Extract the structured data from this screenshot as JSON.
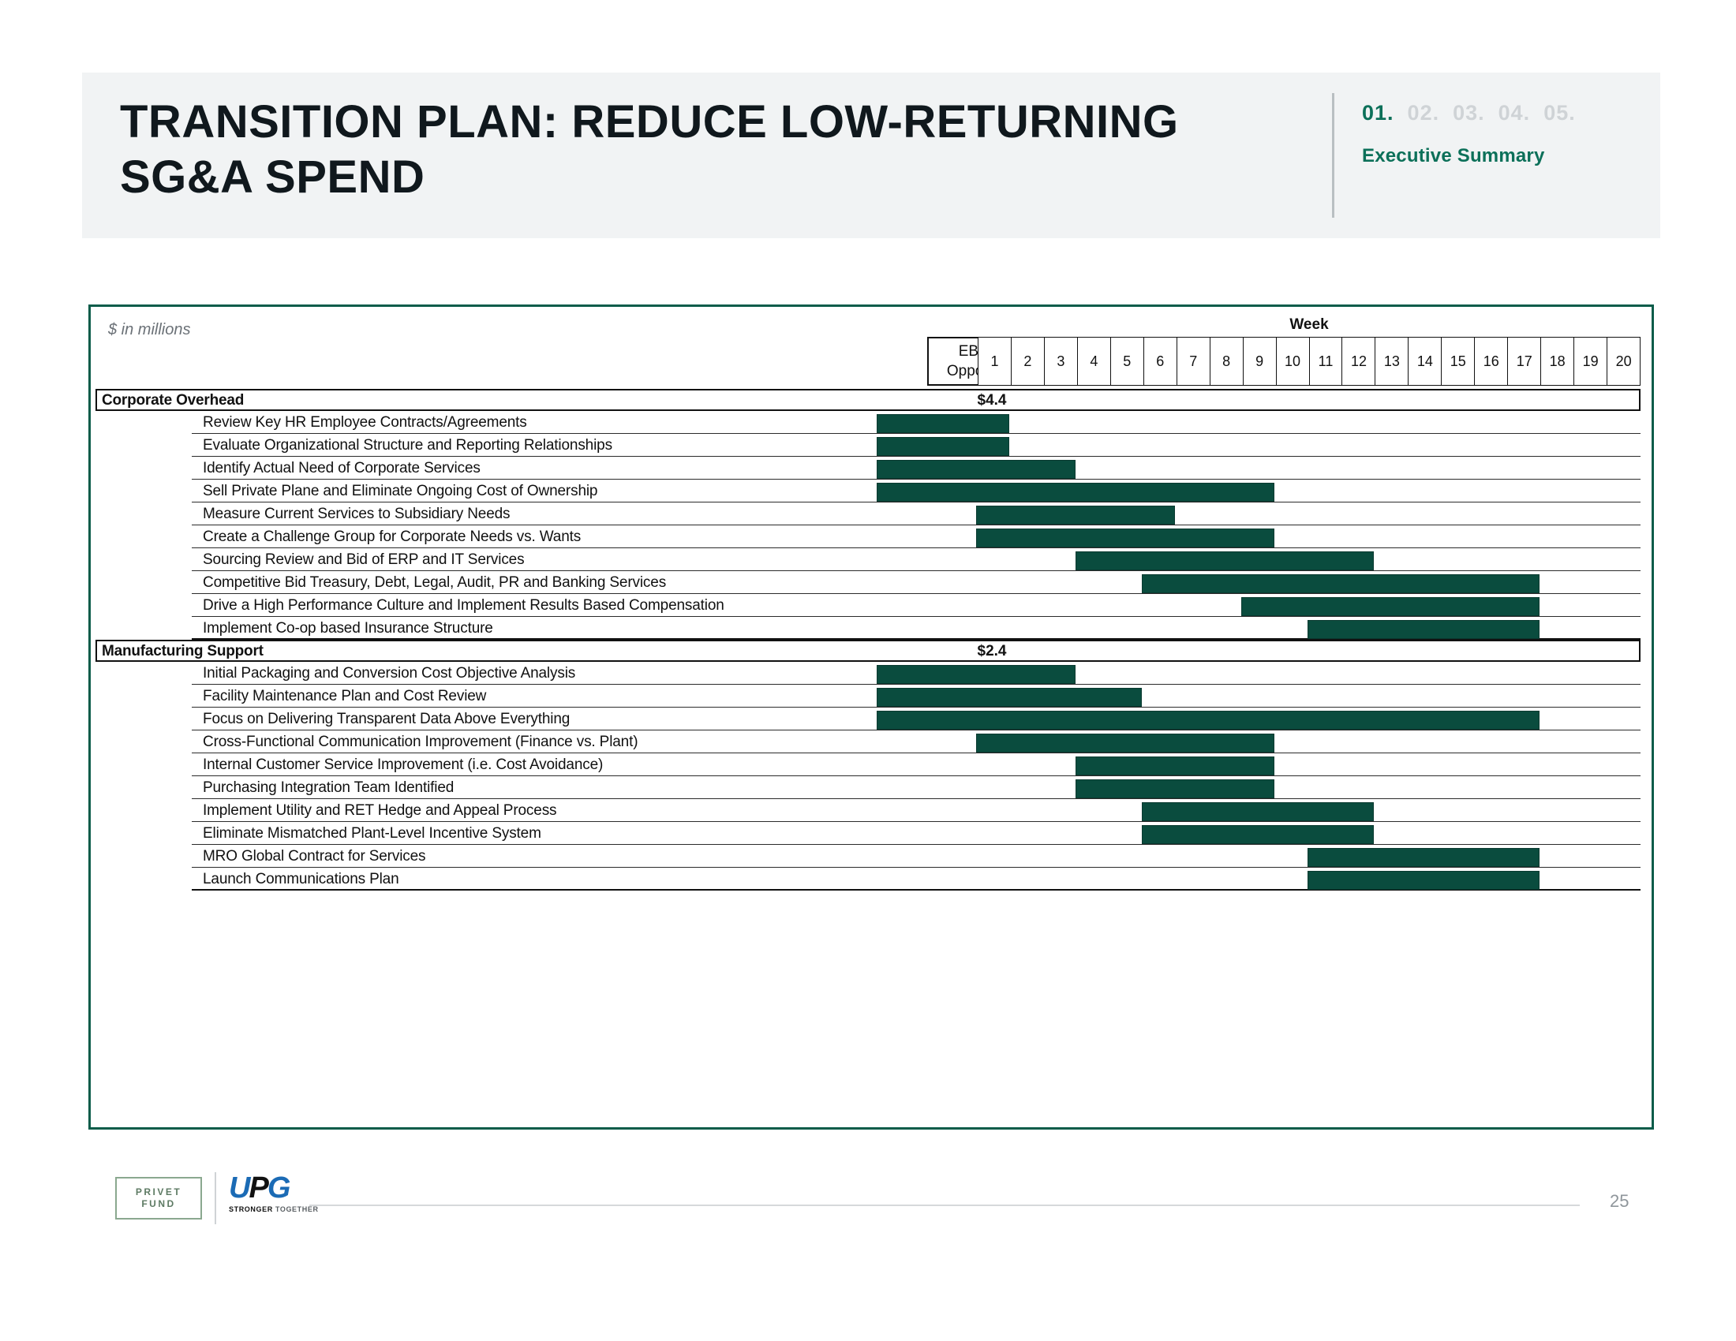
{
  "header": {
    "title": "TRANSITION PLAN: REDUCE LOW-RETURNING SG&A SPEND",
    "steps": [
      {
        "label": "01.",
        "active": true
      },
      {
        "label": "02.",
        "active": false
      },
      {
        "label": "03.",
        "active": false
      },
      {
        "label": "04.",
        "active": false
      },
      {
        "label": "05.",
        "active": false
      }
    ],
    "section_label": "Executive Summary",
    "accent_color": "#0c7059",
    "inactive_color": "#cfd3d6"
  },
  "chart": {
    "units_note": "$ in millions",
    "ebitda_header_line1": "EBITDA",
    "ebitda_header_line2": "Opportunity",
    "week_header": "Week",
    "bar_color": "#0a4c3e",
    "border_color": "#0b5c4a"
  },
  "chart_data": {
    "type": "bar",
    "title": "TRANSITION PLAN: REDUCE LOW-RETURNING SG&A SPEND",
    "subtitle": "$ in millions",
    "xlabel": "Week",
    "ylabel": "",
    "x_ticks": [
      1,
      2,
      3,
      4,
      5,
      6,
      7,
      8,
      9,
      10,
      11,
      12,
      13,
      14,
      15,
      16,
      17,
      18,
      19,
      20
    ],
    "xlim": [
      1,
      20
    ],
    "grid": true,
    "legend": "none",
    "groups": [
      {
        "name": "Corporate Overhead",
        "ebitda_opportunity": "$4.4",
        "tasks": [
          {
            "label": "Review Key HR Employee Contracts/Agreements",
            "start_week": 1,
            "end_week": 4
          },
          {
            "label": "Evaluate Organizational Structure and Reporting Relationships",
            "start_week": 1,
            "end_week": 4
          },
          {
            "label": "Identify Actual Need of Corporate Services",
            "start_week": 1,
            "end_week": 6
          },
          {
            "label": "Sell Private Plane and Eliminate Ongoing Cost of Ownership",
            "start_week": 1,
            "end_week": 12
          },
          {
            "label": "Measure Current Services to Subsidiary Needs",
            "start_week": 4,
            "end_week": 9
          },
          {
            "label": "Create a Challenge Group for Corporate Needs vs. Wants",
            "start_week": 4,
            "end_week": 12
          },
          {
            "label": "Sourcing Review and Bid of ERP and IT Services",
            "start_week": 7,
            "end_week": 15
          },
          {
            "label": "Competitive Bid Treasury, Debt, Legal, Audit, PR and Banking Services",
            "start_week": 9,
            "end_week": 20
          },
          {
            "label": "Drive a High Performance Culture and Implement Results Based Compensation",
            "start_week": 12,
            "end_week": 20
          },
          {
            "label": "Implement Co-op based Insurance Structure",
            "start_week": 14,
            "end_week": 20
          }
        ]
      },
      {
        "name": "Manufacturing Support",
        "ebitda_opportunity": "$2.4",
        "tasks": [
          {
            "label": "Initial Packaging and Conversion Cost Objective Analysis",
            "start_week": 1,
            "end_week": 6
          },
          {
            "label": "Facility Maintenance Plan and Cost Review",
            "start_week": 1,
            "end_week": 8
          },
          {
            "label": "Focus on Delivering Transparent Data Above Everything",
            "start_week": 1,
            "end_week": 20
          },
          {
            "label": "Cross-Functional Communication Improvement (Finance vs. Plant)",
            "start_week": 4,
            "end_week": 12
          },
          {
            "label": "Internal Customer Service Improvement (i.e. Cost Avoidance)",
            "start_week": 7,
            "end_week": 12
          },
          {
            "label": "Purchasing Integration Team Identified",
            "start_week": 7,
            "end_week": 12
          },
          {
            "label": "Implement Utility and RET Hedge and Appeal Process",
            "start_week": 9,
            "end_week": 15
          },
          {
            "label": "Eliminate Mismatched Plant-Level Incentive System",
            "start_week": 9,
            "end_week": 15
          },
          {
            "label": "MRO Global Contract for Services",
            "start_week": 14,
            "end_week": 20
          },
          {
            "label": "Launch Communications Plan",
            "start_week": 14,
            "end_week": 20
          }
        ]
      }
    ]
  },
  "footer": {
    "privet_line1": "PRIVET",
    "privet_line2": "FUND",
    "upg_name": "UPG",
    "upg_tagline_strong": "STRONGER",
    "upg_tagline_light": "TOGETHER",
    "page_number": "25"
  }
}
